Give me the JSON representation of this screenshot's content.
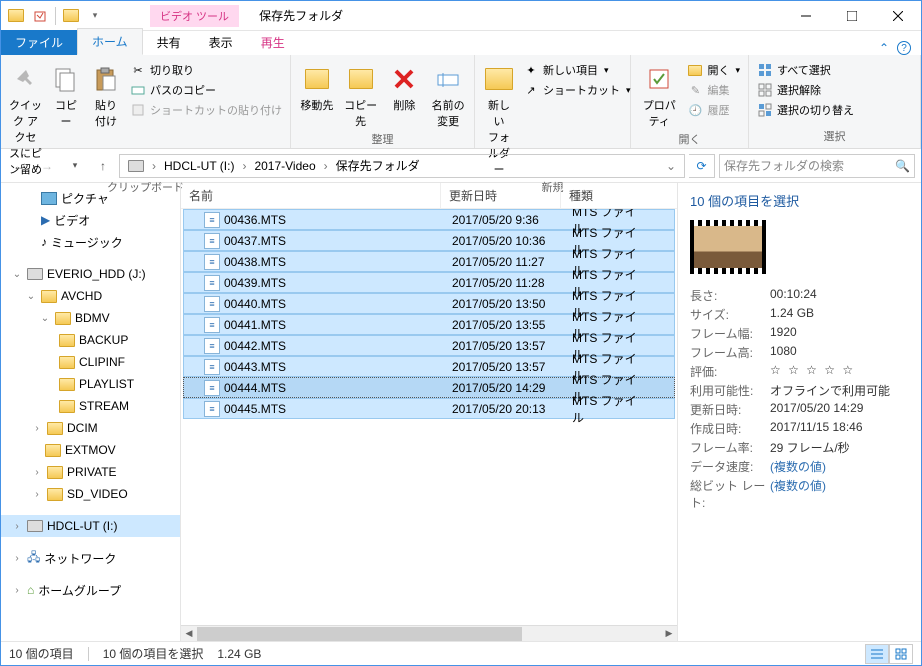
{
  "window": {
    "context_tab": "ビデオ ツール",
    "title": "保存先フォルダ"
  },
  "tabs": {
    "file": "ファイル",
    "home": "ホーム",
    "share": "共有",
    "view": "表示",
    "play": "再生"
  },
  "ribbon": {
    "clipboard": {
      "label": "クリップボード",
      "quick_access": "クイック アクセ\nスにピン留め",
      "copy": "コピー",
      "paste": "貼り付け",
      "cut": "切り取り",
      "copy_path": "パスのコピー",
      "paste_shortcut": "ショートカットの貼り付け"
    },
    "organize": {
      "label": "整理",
      "move_to": "移動先",
      "copy_to": "コピー先",
      "delete": "削除",
      "rename": "名前の\n変更"
    },
    "new": {
      "label": "新規",
      "new_folder": "新しい\nフォルダー",
      "new_item": "新しい項目",
      "shortcut": "ショートカット"
    },
    "open": {
      "label": "開く",
      "properties": "プロパティ",
      "open": "開く",
      "edit": "編集",
      "history": "履歴"
    },
    "select": {
      "label": "選択",
      "select_all": "すべて選択",
      "select_none": "選択解除",
      "invert": "選択の切り替え"
    }
  },
  "breadcrumb": [
    "HDCL-UT (I:)",
    "2017-Video",
    "保存先フォルダ"
  ],
  "search": {
    "placeholder": "保存先フォルダの検索"
  },
  "columns": {
    "name": "名前",
    "modified": "更新日時",
    "type": "種類"
  },
  "tree": {
    "pictures": "ピクチャ",
    "videos": "ビデオ",
    "music": "ミュージック",
    "drive_j": "EVERIO_HDD (J:)",
    "avchd": "AVCHD",
    "bdmv": "BDMV",
    "backup": "BACKUP",
    "clipinf": "CLIPINF",
    "playlist": "PLAYLIST",
    "stream": "STREAM",
    "dcim": "DCIM",
    "extmov": "EXTMOV",
    "private": "PRIVATE",
    "sdvideo": "SD_VIDEO",
    "drive_i": "HDCL-UT (I:)",
    "network": "ネットワーク",
    "homegroup": "ホームグループ"
  },
  "files": [
    {
      "name": "00436.MTS",
      "date": "2017/05/20 9:36",
      "type": "MTS ファイル"
    },
    {
      "name": "00437.MTS",
      "date": "2017/05/20 10:36",
      "type": "MTS ファイル"
    },
    {
      "name": "00438.MTS",
      "date": "2017/05/20 11:27",
      "type": "MTS ファイル"
    },
    {
      "name": "00439.MTS",
      "date": "2017/05/20 11:28",
      "type": "MTS ファイル"
    },
    {
      "name": "00440.MTS",
      "date": "2017/05/20 13:50",
      "type": "MTS ファイル"
    },
    {
      "name": "00441.MTS",
      "date": "2017/05/20 13:55",
      "type": "MTS ファイル"
    },
    {
      "name": "00442.MTS",
      "date": "2017/05/20 13:57",
      "type": "MTS ファイル"
    },
    {
      "name": "00443.MTS",
      "date": "2017/05/20 13:57",
      "type": "MTS ファイル"
    },
    {
      "name": "00444.MTS",
      "date": "2017/05/20 14:29",
      "type": "MTS ファイル"
    },
    {
      "name": "00445.MTS",
      "date": "2017/05/20 20:13",
      "type": "MTS ファイル"
    }
  ],
  "focus_index": 8,
  "details": {
    "title": "10 個の項目を選択",
    "props": {
      "length_l": "長さ:",
      "length_v": "00:10:24",
      "size_l": "サイズ:",
      "size_v": "1.24 GB",
      "fw_l": "フレーム幅:",
      "fw_v": "1920",
      "fh_l": "フレーム高:",
      "fh_v": "1080",
      "rating_l": "評価:",
      "avail_l": "利用可能性:",
      "avail_v": "オフラインで利用可能",
      "mod_l": "更新日時:",
      "mod_v": "2017/05/20 14:29",
      "created_l": "作成日時:",
      "created_v": "2017/11/15 18:46",
      "fr_l": "フレーム率:",
      "fr_v": "29 フレーム/秒",
      "dr_l": "データ速度:",
      "dr_v": "(複数の値)",
      "br_l": "総ビット レート:",
      "br_v": "(複数の値)"
    }
  },
  "status": {
    "count": "10 個の項目",
    "selected": "10 個の項目を選択",
    "size": "1.24 GB"
  }
}
